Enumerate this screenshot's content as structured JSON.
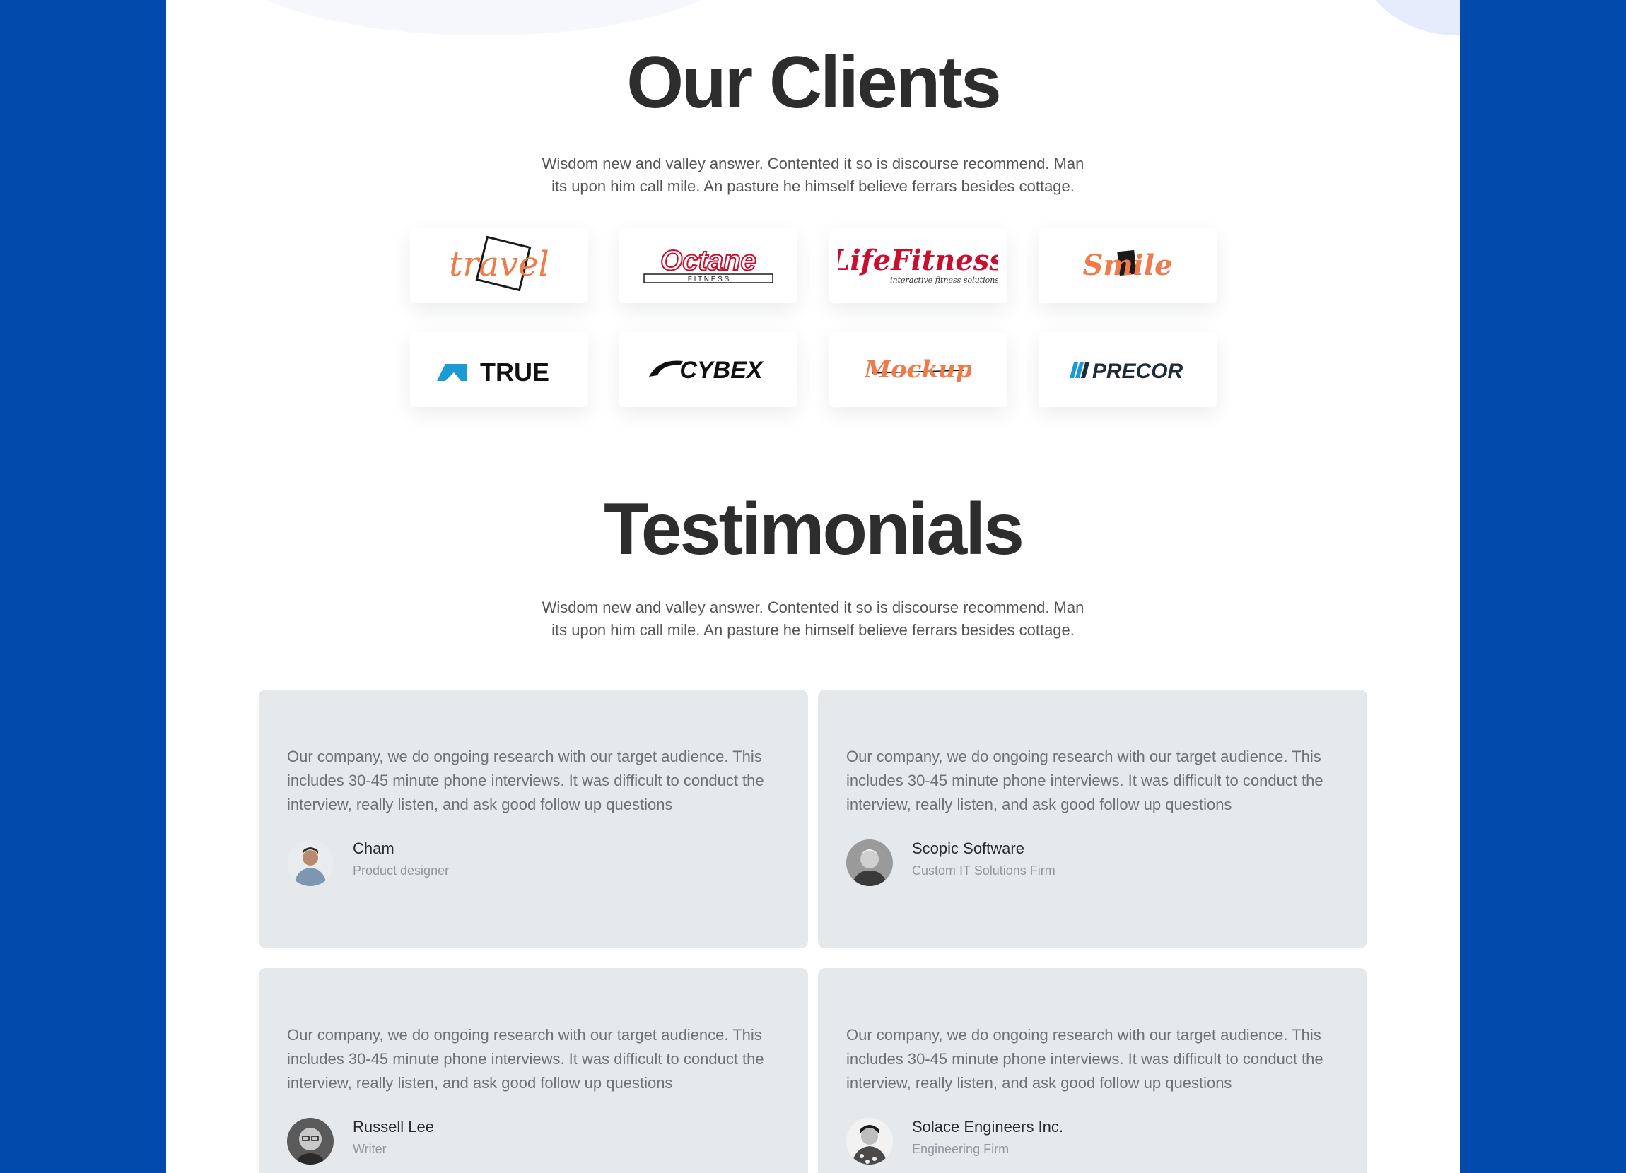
{
  "clients": {
    "title": "Our Clients",
    "subtitle_line1": "Wisdom new and valley answer. Contented it so is discourse recommend. Man",
    "subtitle_line2": "its upon him call mile. An pasture he himself believe ferrars besides cottage.",
    "logos": [
      {
        "name": "travel",
        "text": "travel",
        "color": "#f07a4a"
      },
      {
        "name": "octane",
        "text": "Octane",
        "sub": "F I T N E S S",
        "color": "#c8102e"
      },
      {
        "name": "lifefitness",
        "text": "LifeFitness",
        "sub": "interactive fitness solutions",
        "color": "#c8102e"
      },
      {
        "name": "smile",
        "text": "Smile",
        "color": "#f07a4a"
      },
      {
        "name": "true",
        "text": "TRUE",
        "color": "#111111",
        "accent": "#1b9ad6"
      },
      {
        "name": "cybex",
        "text": "CYBEX",
        "color": "#111111"
      },
      {
        "name": "mockup",
        "text": "Mockup",
        "color": "#f07a4a"
      },
      {
        "name": "precor",
        "text": "PRECOR",
        "color": "#1d2b3a",
        "accent": "#1b9ad6"
      }
    ]
  },
  "testimonials": {
    "title": "Testimonials",
    "subtitle_line1": "Wisdom new and valley answer. Contented it so is discourse recommend. Man",
    "subtitle_line2": "its upon him call mile. An pasture he himself believe ferrars besides cottage.",
    "items": [
      {
        "quote": "Our company, we do ongoing research with our target audience. This includes 30-45 minute phone interviews. It was difficult to conduct the interview, really listen, and ask good follow up questions",
        "name": "Cham",
        "role": "Product designer"
      },
      {
        "quote": "Our company, we do ongoing research with our target audience. This includes 30-45 minute phone interviews. It was difficult to conduct the interview, really listen, and ask good follow up questions",
        "name": "Scopic Software",
        "role": "Custom IT Solutions Firm"
      },
      {
        "quote": "Our company, we do ongoing research with our target audience. This includes 30-45 minute phone interviews. It was difficult to conduct the interview, really listen, and ask good follow up questions",
        "name": "Russell Lee",
        "role": "Writer"
      },
      {
        "quote": "Our company, we do ongoing research with our target audience. This includes 30-45 minute phone interviews. It was difficult to conduct the interview, really listen, and ask good follow up questions",
        "name": "Solace Engineers Inc.",
        "role": "Engineering Firm"
      }
    ]
  },
  "colors": {
    "frame": "#034aad",
    "card_bg": "#e6e9ec",
    "heading": "#2d2d2d"
  }
}
